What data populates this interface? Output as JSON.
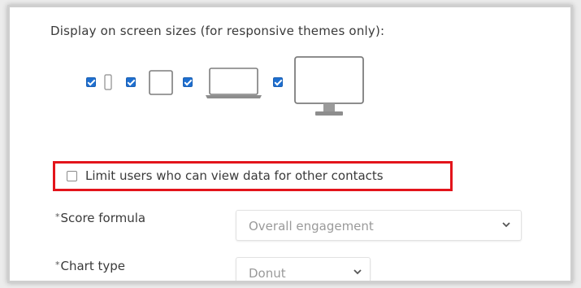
{
  "display_section": {
    "heading": "Display on screen sizes (for responsive themes only):",
    "devices": [
      {
        "name": "phone",
        "checked": true
      },
      {
        "name": "tablet",
        "checked": true
      },
      {
        "name": "laptop",
        "checked": true
      },
      {
        "name": "desktop",
        "checked": true
      }
    ]
  },
  "limit_option": {
    "label": "Limit users who can view data for other contacts",
    "checked": false,
    "highlight_color": "#e3141b"
  },
  "fields": {
    "score_formula": {
      "required_mark": "*",
      "label": "Score formula",
      "value": "Overall engagement"
    },
    "chart_type": {
      "required_mark": "*",
      "label": "Chart type",
      "value": "Donut"
    }
  },
  "colors": {
    "checkbox_checked": "#1e6fd0",
    "text": "#3a3a3a",
    "select_text": "#9a9a9a"
  }
}
